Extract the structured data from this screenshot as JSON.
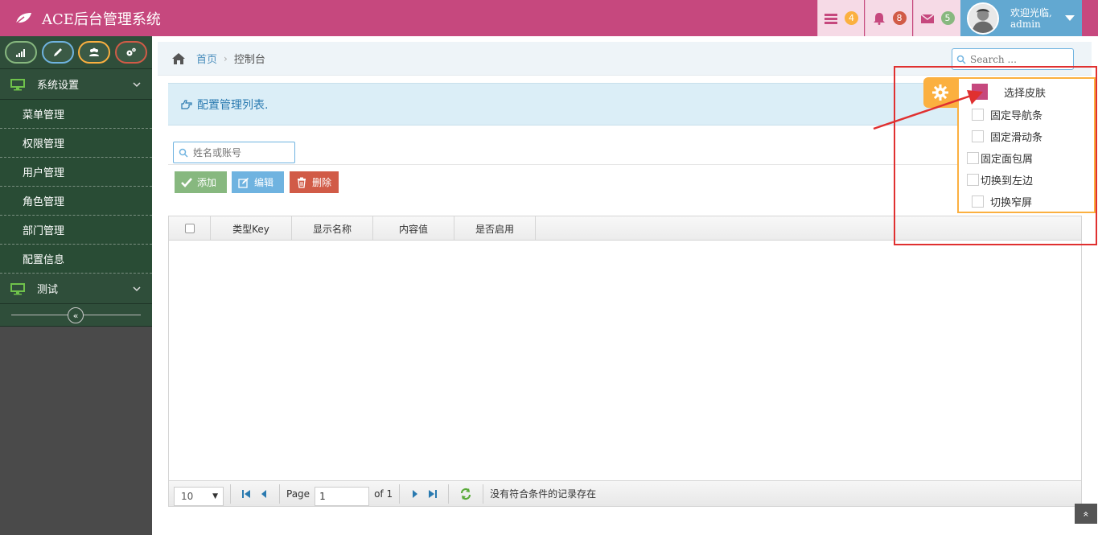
{
  "navbar": {
    "brand": "ACE后台管理系统",
    "tasks_badge": "4",
    "bell_badge": "8",
    "mail_badge": "5",
    "user_greeting": "欢迎光临,",
    "user_name": "admin",
    "colors": {
      "nav": "#c6487e",
      "user": "#62a8d1",
      "tasks": "#fbb040",
      "bell": "#d15b47",
      "mail": "#87b87f"
    }
  },
  "sidebar": {
    "shortcuts": [
      "signal-icon",
      "pencil-icon",
      "users-icon",
      "cogs-icon"
    ],
    "group1": "系统设置",
    "items": [
      "菜单管理",
      "权限管理",
      "用户管理",
      "角色管理",
      "部门管理",
      "配置信息"
    ],
    "group2": "测试"
  },
  "breadcrumb": {
    "home": "首页",
    "current": "控制台"
  },
  "search": {
    "placeholder": "Search ..."
  },
  "page_header": "配置管理列表.",
  "filter": {
    "placeholder": "姓名或账号"
  },
  "buttons": {
    "add": "添加",
    "edit": "编辑",
    "delete": "删除"
  },
  "grid": {
    "columns": [
      "类型Key",
      "显示名称",
      "内容值",
      "是否启用"
    ],
    "rows": []
  },
  "pager": {
    "page_size": "10",
    "page_label": "Page",
    "page_value": "1",
    "of_label": "of 1",
    "status": "没有符合条件的记录存在"
  },
  "settings": {
    "skin_label": "选择皮肤",
    "options": [
      "固定导航条",
      "固定滑动条",
      "固定面包屑",
      "切换到左边",
      "切换窄屏"
    ]
  }
}
